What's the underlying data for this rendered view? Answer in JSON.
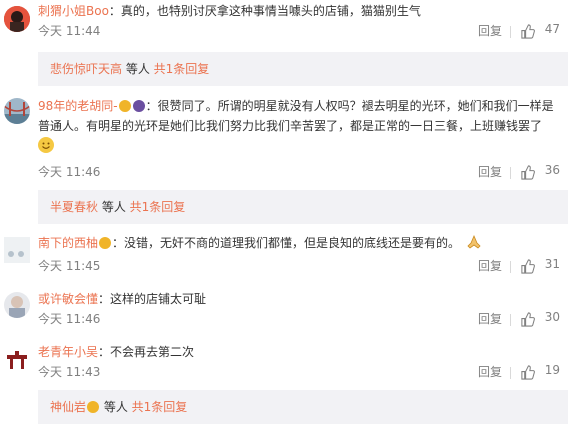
{
  "comments": [
    {
      "user": "刺猬小姐Boo",
      "text": "：真的，也特别讨厌拿这种事情当噱头的店铺，猫猫别生气",
      "time": "今天 11:44",
      "reply": "回复",
      "likes": "47",
      "sub_user": "悲伤惊吓天高",
      "sub_mid": " 等人 ",
      "sub_more": "共1条回复"
    },
    {
      "user": "98年的老胡同-",
      "text": "：很赞同了。所谓的明星就没有人权吗？褪去明星的光环，她们和我们一样是普通人。有明星的光环是她们比我们努力比我们辛苦罢了，都是正常的一日三餐，上班赚钱罢了",
      "time": "今天 11:46",
      "reply": "回复",
      "likes": "36",
      "sub_user": "半夏春秋",
      "sub_mid": " 等人 ",
      "sub_more": "共1条回复"
    },
    {
      "user": "南下的西柚",
      "text": "：没错，无奸不商的道理我们都懂，但是良知的底线还是要有的。",
      "time": "今天 11:45",
      "reply": "回复",
      "likes": "31"
    },
    {
      "user": "或许敏会懂",
      "text": "：这样的店铺太可耻",
      "time": "今天 11:46",
      "reply": "回复",
      "likes": "30"
    },
    {
      "user": "老青年小吴",
      "text": "：不会再去第二次",
      "time": "今天 11:43",
      "reply": "回复",
      "likes": "19",
      "sub_user": "神仙岩",
      "sub_mid": " 等人 ",
      "sub_more": "共1条回复"
    }
  ],
  "colors": {
    "username": "#eb7350",
    "meta": "#808080",
    "subbox": "#f2f2f5"
  },
  "icons": {
    "like": "thumbs-up-icon",
    "emoji": "smile-emoji-icon",
    "pray": "praying-hands-icon"
  }
}
